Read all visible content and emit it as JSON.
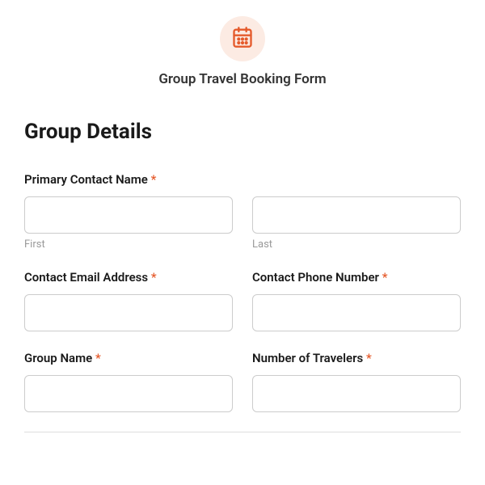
{
  "header": {
    "title": "Group Travel Booking Form",
    "icon": "calendar-icon"
  },
  "section": {
    "title": "Group Details"
  },
  "fields": {
    "primaryContact": {
      "label": "Primary Contact Name",
      "first": {
        "sublabel": "First",
        "value": ""
      },
      "last": {
        "sublabel": "Last",
        "value": ""
      }
    },
    "email": {
      "label": "Contact Email Address",
      "value": ""
    },
    "phone": {
      "label": "Contact Phone Number",
      "value": ""
    },
    "groupName": {
      "label": "Group Name",
      "value": ""
    },
    "travelers": {
      "label": "Number of Travelers",
      "value": ""
    }
  },
  "requiredMark": "*",
  "colors": {
    "accent": "#e55a2b",
    "iconBg": "#fcebe3"
  }
}
